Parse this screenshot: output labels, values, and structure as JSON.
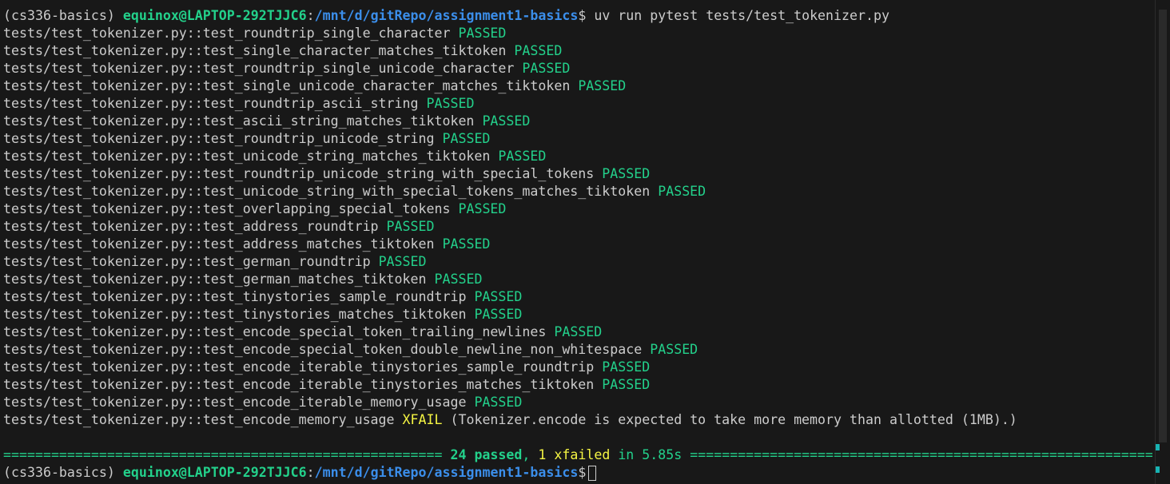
{
  "prompt": {
    "env": "(cs336-basics)",
    "user_host": "equinox@LAPTOP-292TJJC6",
    "colon": ":",
    "path": "/mnt/d/gitRepo/assignment1-basics",
    "symbol": "$",
    "command": " uv run pytest tests/test_tokenizer.py"
  },
  "tests": [
    {
      "name": "tests/test_tokenizer.py::test_roundtrip_single_character",
      "status": "PASSED"
    },
    {
      "name": "tests/test_tokenizer.py::test_single_character_matches_tiktoken",
      "status": "PASSED"
    },
    {
      "name": "tests/test_tokenizer.py::test_roundtrip_single_unicode_character",
      "status": "PASSED"
    },
    {
      "name": "tests/test_tokenizer.py::test_single_unicode_character_matches_tiktoken",
      "status": "PASSED"
    },
    {
      "name": "tests/test_tokenizer.py::test_roundtrip_ascii_string",
      "status": "PASSED"
    },
    {
      "name": "tests/test_tokenizer.py::test_ascii_string_matches_tiktoken",
      "status": "PASSED"
    },
    {
      "name": "tests/test_tokenizer.py::test_roundtrip_unicode_string",
      "status": "PASSED"
    },
    {
      "name": "tests/test_tokenizer.py::test_unicode_string_matches_tiktoken",
      "status": "PASSED"
    },
    {
      "name": "tests/test_tokenizer.py::test_roundtrip_unicode_string_with_special_tokens",
      "status": "PASSED"
    },
    {
      "name": "tests/test_tokenizer.py::test_unicode_string_with_special_tokens_matches_tiktoken",
      "status": "PASSED"
    },
    {
      "name": "tests/test_tokenizer.py::test_overlapping_special_tokens",
      "status": "PASSED"
    },
    {
      "name": "tests/test_tokenizer.py::test_address_roundtrip",
      "status": "PASSED"
    },
    {
      "name": "tests/test_tokenizer.py::test_address_matches_tiktoken",
      "status": "PASSED"
    },
    {
      "name": "tests/test_tokenizer.py::test_german_roundtrip",
      "status": "PASSED"
    },
    {
      "name": "tests/test_tokenizer.py::test_german_matches_tiktoken",
      "status": "PASSED"
    },
    {
      "name": "tests/test_tokenizer.py::test_tinystories_sample_roundtrip",
      "status": "PASSED"
    },
    {
      "name": "tests/test_tokenizer.py::test_tinystories_matches_tiktoken",
      "status": "PASSED"
    },
    {
      "name": "tests/test_tokenizer.py::test_encode_special_token_trailing_newlines",
      "status": "PASSED"
    },
    {
      "name": "tests/test_tokenizer.py::test_encode_special_token_double_newline_non_whitespace",
      "status": "PASSED"
    },
    {
      "name": "tests/test_tokenizer.py::test_encode_iterable_tinystories_sample_roundtrip",
      "status": "PASSED"
    },
    {
      "name": "tests/test_tokenizer.py::test_encode_iterable_tinystories_matches_tiktoken",
      "status": "PASSED"
    },
    {
      "name": "tests/test_tokenizer.py::test_encode_iterable_memory_usage",
      "status": "PASSED"
    },
    {
      "name": "tests/test_tokenizer.py::test_encode_memory_usage",
      "status": "XFAIL",
      "reason": "(Tokenizer.encode is expected to take more memory than allotted (1MB).)"
    }
  ],
  "summary": {
    "left_rule": "=======================================================",
    "passed": "24 passed",
    "sep": ",",
    "xfailed": "1 xfailed",
    "time": "in 5.85s",
    "right_rule": "==========================================================="
  },
  "colors": {
    "background": "#181818",
    "text": "#cccccc",
    "green": "#23d18b",
    "blue": "#3b8eea",
    "yellow": "#f5f543"
  }
}
